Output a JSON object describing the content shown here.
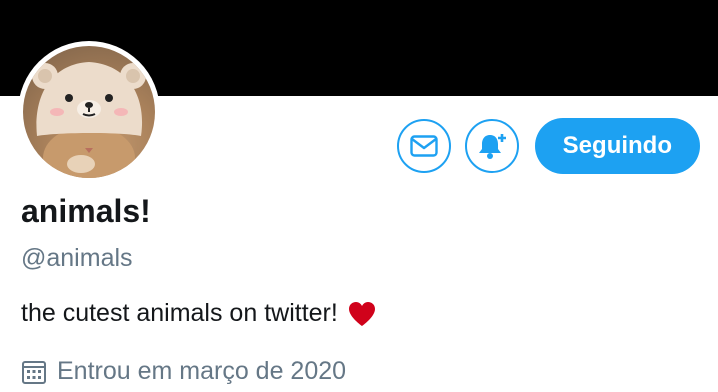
{
  "profile": {
    "name": "animals!",
    "handle": "@animals",
    "bio": "the cutest animals on twitter!",
    "joined": "Entrou em março de 2020"
  },
  "actions": {
    "follow_label": "Seguindo"
  },
  "icons": {
    "message": "envelope-icon",
    "notify": "bell-plus-icon",
    "bio_emoji": "heart-icon",
    "joined": "calendar-icon"
  },
  "colors": {
    "accent": "#1da1f2",
    "banner": "#000000",
    "heart": "#d0021b",
    "secondary_text": "#657786"
  }
}
